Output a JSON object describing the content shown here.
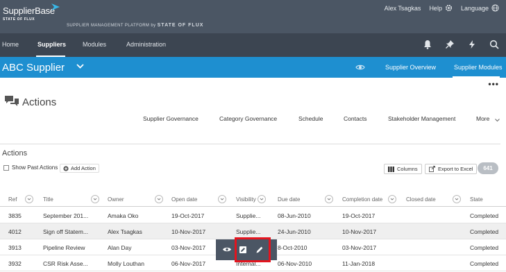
{
  "header": {
    "logo_main": "SupplierBase",
    "logo_sub": "STATE OF FLUX",
    "platform_prefix": "SUPPLIER MANAGEMENT PLATFORM",
    "platform_by": "by",
    "platform_brand": "STATE OF FLUX",
    "user_name": "Alex Tsagkas",
    "help_label": "Help",
    "language_label": "Language"
  },
  "nav": {
    "items": [
      {
        "label": "Home"
      },
      {
        "label": "Suppliers",
        "active": true
      },
      {
        "label": "Modules"
      },
      {
        "label": "Administration"
      }
    ],
    "icons": [
      "bell-icon",
      "pin-icon",
      "lightning-icon",
      "search-icon"
    ]
  },
  "supplier_bar": {
    "name": "ABC Supplier",
    "overview_label": "Supplier Overview",
    "modules_label": "Supplier Modules"
  },
  "page": {
    "title": "Actions",
    "more_dots": "•••",
    "subtabs": [
      "Supplier Governance",
      "Category Governance",
      "Schedule",
      "Contacts",
      "Stakeholder Management",
      "More"
    ]
  },
  "section": {
    "title": "Actions",
    "show_past_label": "Show Past Actions",
    "add_action_label": "Add Action",
    "columns_label": "Columns",
    "export_label": "Export to Excel",
    "count": "641"
  },
  "table": {
    "columns": [
      "Ref",
      "Title",
      "Owner",
      "Open date",
      "Visibility",
      "Due date",
      "Completion date",
      "Closed date",
      "State"
    ],
    "rows": [
      [
        "3835",
        "September 201...",
        "Amaka Oko",
        "19-Oct-2017",
        "Supplie...",
        "08-Jun-2010",
        "19-Oct-2017",
        "",
        "Completed"
      ],
      [
        "4012",
        "Sign off Statem...",
        "Alex Tsagkas",
        "10-Nov-2017",
        "Supplie...",
        "24-Jun-2010",
        "10-Nov-2017",
        "",
        "Completed"
      ],
      [
        "3913",
        "Pipeline Review",
        "Alan Day",
        "03-Nov-2017",
        "",
        "8-Oct-2010",
        "03-Nov-2017",
        "",
        "Completed"
      ],
      [
        "3932",
        "CSR Risk Asse...",
        "Molly Louthan",
        "06-Nov-2017",
        "Internal...",
        "06-Nov-2010",
        "11-Jan-2018",
        "",
        "Completed"
      ]
    ]
  },
  "colors": {
    "header_bg": "#4b5664",
    "nav_bg": "#3c4551",
    "accent_blue": "#1e8fd0",
    "highlight_red": "#e3141e"
  }
}
